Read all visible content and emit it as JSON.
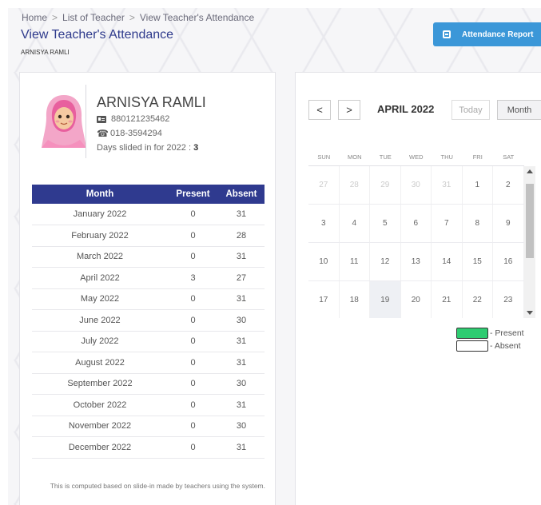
{
  "breadcrumb": {
    "items": [
      "Home",
      "List of Teacher",
      "View Teacher's Attendance"
    ],
    "separator": ">"
  },
  "page": {
    "title": "View Teacher's Attendance",
    "subtitle": "ARNISYA RAMLI"
  },
  "report_button": {
    "label": "Attendance Report",
    "icon": "calendar-icon"
  },
  "teacher": {
    "name": "ARNISYA RAMLI",
    "ic_number": "880121235462",
    "phone": "018-3594294",
    "days_label": "Days slided in for 2022 :",
    "days_value": "3"
  },
  "attendance": {
    "headers": [
      "Month",
      "Present",
      "Absent"
    ],
    "rows": [
      [
        "January 2022",
        "0",
        "31"
      ],
      [
        "February 2022",
        "0",
        "28"
      ],
      [
        "March 2022",
        "0",
        "31"
      ],
      [
        "April 2022",
        "3",
        "27"
      ],
      [
        "May 2022",
        "0",
        "31"
      ],
      [
        "June 2022",
        "0",
        "30"
      ],
      [
        "July 2022",
        "0",
        "31"
      ],
      [
        "August 2022",
        "0",
        "31"
      ],
      [
        "September 2022",
        "0",
        "30"
      ],
      [
        "October 2022",
        "0",
        "31"
      ],
      [
        "November 2022",
        "0",
        "30"
      ],
      [
        "December 2022",
        "0",
        "31"
      ]
    ],
    "footnote": "This is computed based on slide-in made by teachers using the system."
  },
  "calendar": {
    "prev_label": "<",
    "next_label": ">",
    "title": "APRIL 2022",
    "today_label": "Today",
    "month_label": "Month",
    "weekdays": [
      "SUN",
      "MON",
      "TUE",
      "WED",
      "THU",
      "FRI",
      "SAT"
    ],
    "weeks": [
      [
        "27",
        "28",
        "29",
        "30",
        "31",
        "1",
        "2"
      ],
      [
        "3",
        "4",
        "5",
        "6",
        "7",
        "8",
        "9"
      ],
      [
        "10",
        "11",
        "12",
        "13",
        "14",
        "15",
        "16"
      ],
      [
        "17",
        "18",
        "19",
        "20",
        "21",
        "22",
        "23"
      ]
    ],
    "today": "19"
  },
  "legend": {
    "present_label": "- Present",
    "absent_label": "- Absent",
    "present_color": "#2ecc71",
    "absent_color": "#ffffff"
  },
  "colors": {
    "primary": "#2f3a8f",
    "accent": "#3b97d8"
  }
}
